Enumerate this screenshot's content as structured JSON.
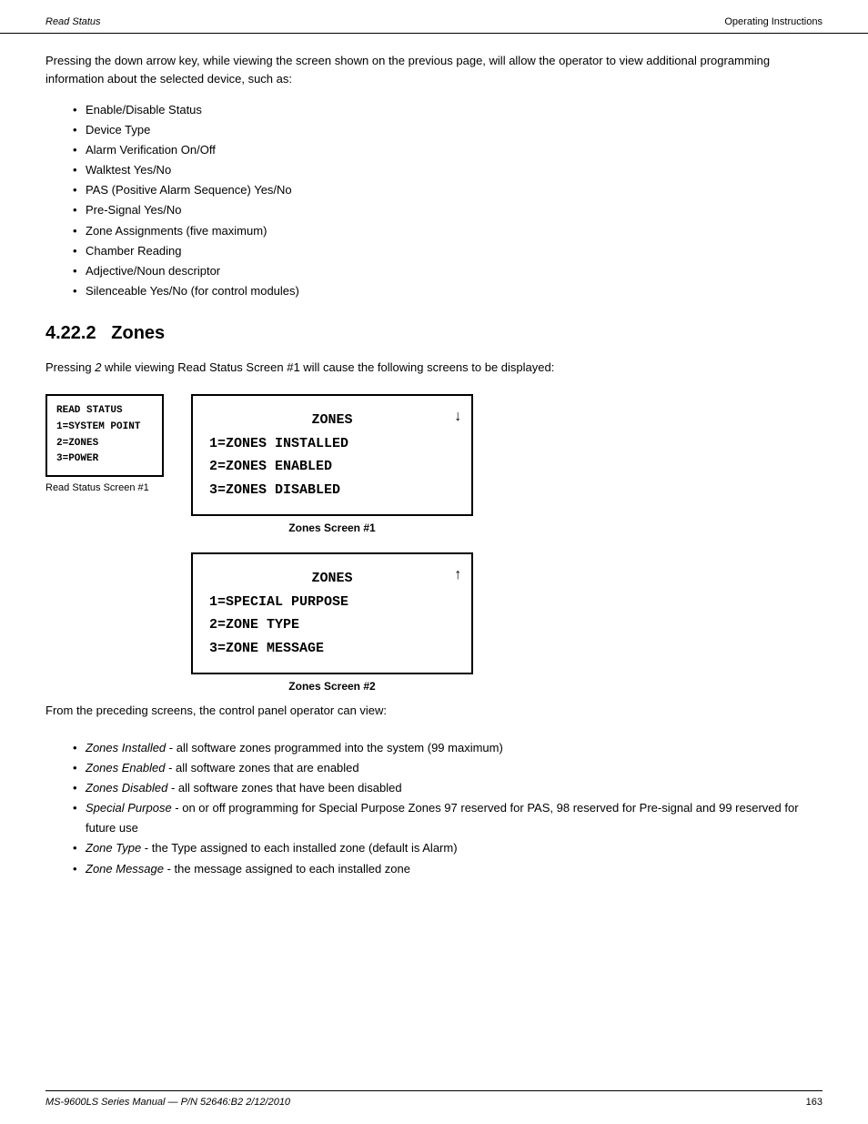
{
  "header": {
    "left": "Read Status",
    "right": "Operating Instructions"
  },
  "footer": {
    "left": "MS-9600LS Series Manual — P/N 52646:B2  2/12/2010",
    "right": "163"
  },
  "intro": {
    "paragraph": "Pressing the down arrow key, while viewing the screen shown on the previous page, will allow the operator to view additional programming information about the selected device, such as:"
  },
  "bullet_items": [
    "Enable/Disable Status",
    "Device Type",
    "Alarm Verification On/Off",
    "Walktest Yes/No",
    "PAS (Positive Alarm Sequence) Yes/No",
    "Pre-Signal Yes/No",
    "Zone Assignments (five maximum)",
    "Chamber Reading",
    "Adjective/Noun descriptor",
    "Silenceable Yes/No (for control modules)"
  ],
  "section": {
    "number": "4.22.2",
    "title": "Zones"
  },
  "section_intro": "Pressing 2 while viewing Read Status Screen #1 will cause the following screens to be displayed:",
  "small_lcd": {
    "lines": [
      "READ STATUS",
      "1=SYSTEM POINT",
      "2=ZONES",
      "3=POWER"
    ],
    "label": "Read Status Screen #1"
  },
  "zones_screen1": {
    "lines": [
      "ZONES",
      "1=ZONES INSTALLED",
      "2=ZONES ENABLED",
      "3=ZONES DISABLED"
    ],
    "arrow": "↓",
    "label": "Zones Screen #1"
  },
  "zones_screen2": {
    "lines": [
      "ZONES",
      "1=SPECIAL PURPOSE",
      "2=ZONE TYPE",
      "3=ZONE MESSAGE"
    ],
    "arrow": "↑",
    "label": "Zones Screen #2"
  },
  "desc_intro": "From the preceding screens, the control panel operator can view:",
  "desc_items": [
    {
      "italic": "Zones Installed",
      "rest": " - all software zones programmed into the system (99 maximum)"
    },
    {
      "italic": "Zones Enabled",
      "rest": " - all software zones that are enabled"
    },
    {
      "italic": "Zones Disabled",
      "rest": " - all software zones that have been disabled"
    },
    {
      "italic": "Special Purpose",
      "rest": " - on or off programming for Special Purpose Zones 97 reserved for PAS, 98 reserved for Pre-signal and 99 reserved for future use"
    },
    {
      "italic": "Zone Type",
      "rest": " - the Type assigned to each installed zone (default is Alarm)"
    },
    {
      "italic": "Zone Message",
      "rest": " - the message assigned to each installed zone"
    }
  ]
}
